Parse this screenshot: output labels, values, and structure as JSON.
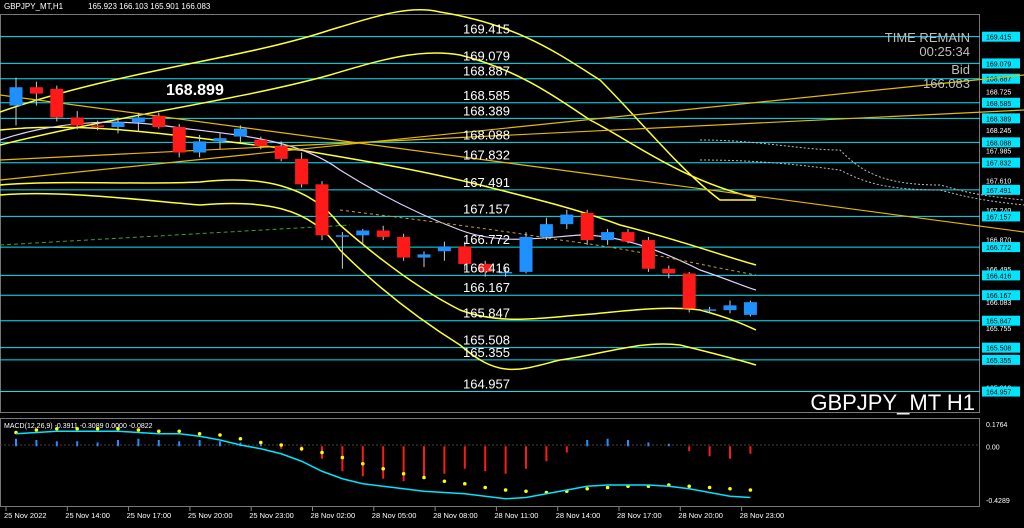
{
  "header": {
    "symbol": "GBPJPY_MT,H1",
    "ohlc": "165.923 166.103 165.901 166.083"
  },
  "overlay": {
    "time_remain_label": "TIME REMAIN",
    "time_remain_value": "00:25:34",
    "bid_label": "Bid",
    "bid_value": "166.083",
    "symbol_label": "GBPJPY_MT H1",
    "highlight_level": "168.899"
  },
  "colors": {
    "background": "#000000",
    "bull": "#1e90ff",
    "bear": "#ff1a1a",
    "level_line": "#00e5ff",
    "bands": "#ffff33",
    "trendline": "#e6b800",
    "macd_signal": "#ffff00",
    "macd_line": "#00e5ff"
  },
  "chart_data": [
    {
      "type": "candlestick",
      "symbol": "GBPJPY_MT",
      "timeframe": "H1",
      "ylim": [
        164.7,
        169.7
      ],
      "y_ticks": [
        "169.415",
        "169.079",
        "168.887",
        "168.725",
        "168.585",
        "168.389",
        "168.245",
        "168.088",
        "167.985",
        "167.832",
        "167.610",
        "167.491",
        "167.240",
        "167.157",
        "166.870",
        "166.772",
        "166.495",
        "166.416",
        "166.167",
        "166.083",
        "165.847",
        "165.755",
        "165.508",
        "165.355",
        "165.010",
        "164.957"
      ],
      "x_ticks": [
        "25 Nov 2022",
        "25 Nov 14:00",
        "25 Nov 17:00",
        "25 Nov 20:00",
        "25 Nov 23:00",
        "28 Nov 02:00",
        "28 Nov 05:00",
        "28 Nov 08:00",
        "28 Nov 11:00",
        "28 Nov 14:00",
        "28 Nov 17:00",
        "28 Nov 20:00",
        "28 Nov 23:00"
      ],
      "levels": [
        "169.415",
        "169.079",
        "168.887",
        "168.585",
        "168.389",
        "168.088",
        "167.832",
        "167.491",
        "167.157",
        "166.772",
        "166.416",
        "166.167",
        "165.847",
        "165.508",
        "165.355",
        "164.957"
      ],
      "candles": [
        {
          "o": 168.55,
          "h": 168.9,
          "l": 168.3,
          "c": 168.78
        },
        {
          "o": 168.78,
          "h": 168.85,
          "l": 168.55,
          "c": 168.7
        },
        {
          "o": 168.76,
          "h": 168.8,
          "l": 168.35,
          "c": 168.4
        },
        {
          "o": 168.4,
          "h": 168.48,
          "l": 168.25,
          "c": 168.3
        },
        {
          "o": 168.3,
          "h": 168.36,
          "l": 168.24,
          "c": 168.28
        },
        {
          "o": 168.28,
          "h": 168.4,
          "l": 168.2,
          "c": 168.34
        },
        {
          "o": 168.34,
          "h": 168.46,
          "l": 168.22,
          "c": 168.4
        },
        {
          "o": 168.42,
          "h": 168.46,
          "l": 168.26,
          "c": 168.28
        },
        {
          "o": 168.28,
          "h": 168.32,
          "l": 167.9,
          "c": 167.96
        },
        {
          "o": 167.96,
          "h": 168.18,
          "l": 167.9,
          "c": 168.1
        },
        {
          "o": 168.1,
          "h": 168.2,
          "l": 168.0,
          "c": 168.14
        },
        {
          "o": 168.16,
          "h": 168.3,
          "l": 168.08,
          "c": 168.26
        },
        {
          "o": 168.12,
          "h": 168.16,
          "l": 168.0,
          "c": 168.04
        },
        {
          "o": 168.04,
          "h": 168.1,
          "l": 167.85,
          "c": 167.88
        },
        {
          "o": 167.88,
          "h": 167.96,
          "l": 167.52,
          "c": 167.56
        },
        {
          "o": 167.56,
          "h": 167.6,
          "l": 166.86,
          "c": 166.92
        },
        {
          "o": 166.92,
          "h": 166.96,
          "l": 166.5,
          "c": 166.92
        },
        {
          "o": 166.92,
          "h": 167.0,
          "l": 166.8,
          "c": 166.98
        },
        {
          "o": 166.98,
          "h": 167.04,
          "l": 166.86,
          "c": 166.9
        },
        {
          "o": 166.9,
          "h": 166.94,
          "l": 166.6,
          "c": 166.64
        },
        {
          "o": 166.64,
          "h": 166.72,
          "l": 166.52,
          "c": 166.68
        },
        {
          "o": 166.72,
          "h": 166.84,
          "l": 166.6,
          "c": 166.78
        },
        {
          "o": 166.78,
          "h": 166.84,
          "l": 166.48,
          "c": 166.56
        },
        {
          "o": 166.56,
          "h": 166.6,
          "l": 166.4,
          "c": 166.46
        },
        {
          "o": 166.46,
          "h": 166.52,
          "l": 166.4,
          "c": 166.46
        },
        {
          "o": 166.46,
          "h": 166.96,
          "l": 166.44,
          "c": 166.9
        },
        {
          "o": 166.9,
          "h": 167.14,
          "l": 166.86,
          "c": 167.06
        },
        {
          "o": 167.06,
          "h": 167.24,
          "l": 167.0,
          "c": 167.18
        },
        {
          "o": 167.2,
          "h": 167.24,
          "l": 166.8,
          "c": 166.86
        },
        {
          "o": 166.86,
          "h": 167.0,
          "l": 166.8,
          "c": 166.96
        },
        {
          "o": 166.96,
          "h": 167.0,
          "l": 166.82,
          "c": 166.84
        },
        {
          "o": 166.86,
          "h": 166.9,
          "l": 166.46,
          "c": 166.5
        },
        {
          "o": 166.5,
          "h": 166.54,
          "l": 166.38,
          "c": 166.44
        },
        {
          "o": 166.44,
          "h": 166.46,
          "l": 165.95,
          "c": 166.0
        },
        {
          "o": 165.98,
          "h": 166.02,
          "l": 165.94,
          "c": 165.99
        },
        {
          "o": 165.98,
          "h": 166.1,
          "l": 165.94,
          "c": 166.04
        },
        {
          "o": 165.92,
          "h": 166.1,
          "l": 165.9,
          "c": 166.08
        }
      ]
    },
    {
      "type": "bar",
      "title": "MACD(12,26,9) -0.3911 -0.3089 0.0000 -0.0822",
      "y_ticks": [
        "0.1764",
        "0.00",
        "-0.4289"
      ],
      "ylim": [
        -0.47,
        0.21
      ],
      "histogram": [
        0.06,
        0.05,
        0.04,
        0.04,
        0.03,
        0.05,
        0.06,
        0.05,
        0.04,
        0.05,
        0.04,
        0.03,
        0.02,
        -0.02,
        -0.04,
        -0.1,
        -0.2,
        -0.24,
        -0.26,
        -0.28,
        -0.25,
        -0.22,
        -0.18,
        -0.2,
        -0.22,
        -0.18,
        -0.12,
        -0.05,
        0.05,
        0.06,
        0.05,
        0.03,
        0.02,
        -0.04,
        -0.08,
        -0.1,
        -0.06
      ],
      "series": [
        {
          "name": "signal",
          "values": [
            0.11,
            0.13,
            0.14,
            0.14,
            0.14,
            0.14,
            0.13,
            0.12,
            0.12,
            0.1,
            0.09,
            0.06,
            0.03,
            0.01,
            -0.02,
            -0.05,
            -0.09,
            -0.14,
            -0.18,
            -0.22,
            -0.25,
            -0.28,
            -0.3,
            -0.33,
            -0.35,
            -0.36,
            -0.37,
            -0.36,
            -0.34,
            -0.33,
            -0.32,
            -0.32,
            -0.31,
            -0.32,
            -0.33,
            -0.34,
            -0.35
          ]
        },
        {
          "name": "macd",
          "values": [
            0.1,
            0.11,
            0.12,
            0.12,
            0.12,
            0.12,
            0.11,
            0.1,
            0.1,
            0.08,
            0.05,
            0.01,
            -0.02,
            -0.06,
            -0.12,
            -0.2,
            -0.26,
            -0.3,
            -0.32,
            -0.34,
            -0.36,
            -0.37,
            -0.38,
            -0.4,
            -0.42,
            -0.41,
            -0.38,
            -0.35,
            -0.32,
            -0.31,
            -0.31,
            -0.31,
            -0.32,
            -0.34,
            -0.37,
            -0.4,
            -0.41
          ]
        }
      ]
    }
  ]
}
